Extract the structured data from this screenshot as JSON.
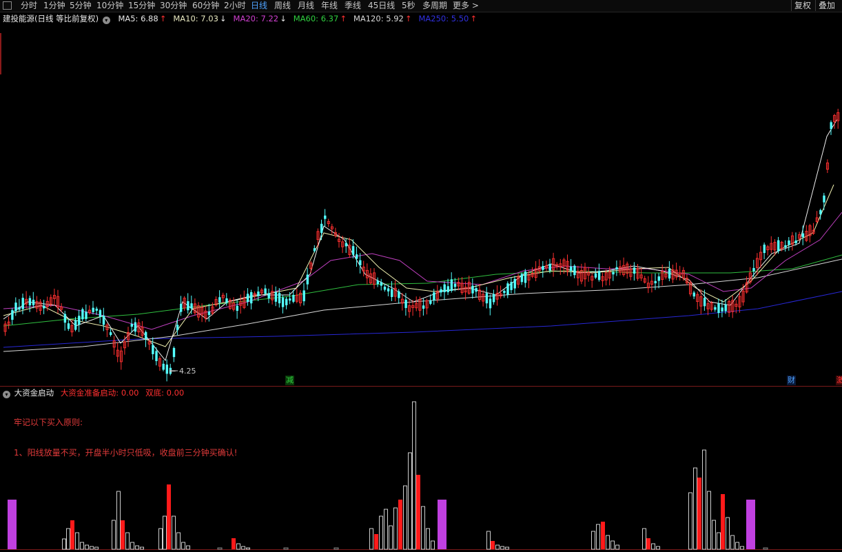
{
  "toolbar": {
    "menu_icon": "window-menu-icon",
    "periods": [
      "分时",
      "1分钟",
      "5分钟",
      "10分钟",
      "15分钟",
      "30分钟",
      "60分钟",
      "2小时",
      "日线",
      "周线",
      "月线",
      "年线",
      "季线",
      "45日线",
      "5秒",
      "多周期",
      "更多 >"
    ],
    "active_period": "日线",
    "restore_label": "复权",
    "overlay_label": "叠加"
  },
  "main_legend": {
    "title": "建投能源(日线 等比前复权)",
    "toggle_icon": "collapse-circle-icon",
    "ma": [
      {
        "label": "MA5: 6.88",
        "arrow": "↑",
        "color": "#e8e8e8",
        "arrow_color": "#ff3030"
      },
      {
        "label": "MA10: 7.03",
        "arrow": "↓",
        "color": "#e8e8c0",
        "arrow_color": "#e8e8e8"
      },
      {
        "label": "MA20: 7.22",
        "arrow": "↓",
        "color": "#d040d0",
        "arrow_color": "#e8e8e8"
      },
      {
        "label": "MA60: 6.37",
        "arrow": "↑",
        "color": "#30d040",
        "arrow_color": "#ff3030"
      },
      {
        "label": "MA120: 5.92",
        "arrow": "↑",
        "color": "#d8d8d8",
        "arrow_color": "#ff3030"
      },
      {
        "label": "MA250: 5.50",
        "arrow": "↑",
        "color": "#3030e0",
        "arrow_color": "#ff3030"
      }
    ]
  },
  "price_chart": {
    "low_label": "4.25",
    "colors": {
      "up": "#ff3030",
      "down": "#54ffff",
      "ma5": "#f0f0f0",
      "ma10": "#f0f0b0",
      "ma20": "#c040c0",
      "ma60": "#30c040",
      "ma120": "#d8d8d8",
      "ma250": "#2828d8"
    },
    "markers": [
      {
        "text": "减",
        "color": "#30d040"
      },
      {
        "text": "财",
        "color": "#4fa3ff"
      },
      {
        "text": "激",
        "color": "#ff3030"
      }
    ]
  },
  "indicator": {
    "title": "大资金启动",
    "toggle_icon": "collapse-circle-icon",
    "line1": "大资金准备启动: 0.00",
    "line2": "双底: 0.00",
    "note_title": "牢记以下买入原则:",
    "note_rule": "1、阳线放量不买，开盘半小时只低吸，收盘前三分钟买确认!",
    "colors": {
      "white_bar": "#d0d0d0",
      "red_bar": "#ff1a1a",
      "purple_bar": "#c040e0"
    }
  }
}
